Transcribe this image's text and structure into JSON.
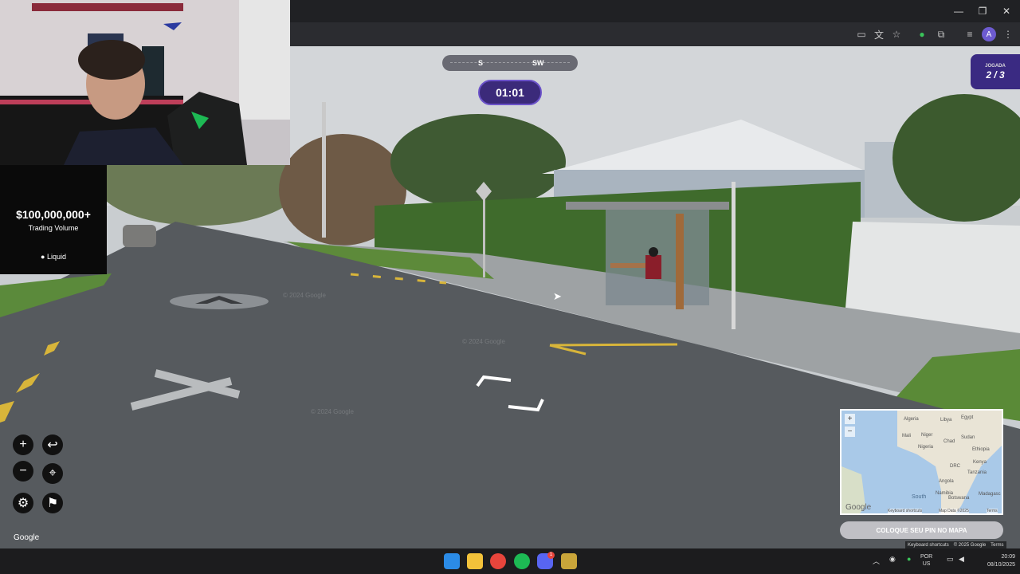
{
  "window": {
    "minimize": "—",
    "maximize": "❐",
    "close": "✕"
  },
  "profile_initial": "A",
  "stream_ad": {
    "amount": "$100,000,000+",
    "subtitle": "Trading Volume",
    "brand": "Liquid"
  },
  "compass": {
    "left": "S",
    "right": "SW"
  },
  "timer": "01:01",
  "round": {
    "label": "JOGADA",
    "value": "2 / 3"
  },
  "controls": {
    "zoom_in": "+",
    "zoom_out": "−",
    "back": "↩",
    "return_to_start": "⌖"
  },
  "google_logo": "Google",
  "minimap": {
    "labels": [
      "Algeria",
      "Libya",
      "Egypt",
      "Mali",
      "Niger",
      "Chad",
      "Sudan",
      "Nigeria",
      "Ethiopia",
      "DRC",
      "Kenya",
      "Tanzania",
      "Angola",
      "Namibia",
      "Botswana",
      "South",
      "Madagasc"
    ],
    "zoom_in": "+",
    "zoom_out": "−",
    "logo": "Google",
    "shortcuts": "Keyboard shortcuts",
    "attribution": "Map Data ©2025",
    "terms": "Terms"
  },
  "guess_button": "COLOQUE SEU PIN NO MAPA",
  "streetview_footer": {
    "shortcuts": "Keyboard shortcuts",
    "copyright": "© 2025 Google",
    "terms": "Terms"
  },
  "watermarks": [
    "© 2024 Google",
    "© 2024 Google",
    "© 2024 Google"
  ],
  "tray": {
    "lang1": "POR",
    "lang2": "US",
    "time": "20:09",
    "date": "08/10/2025"
  },
  "taskbar_badge": "1"
}
